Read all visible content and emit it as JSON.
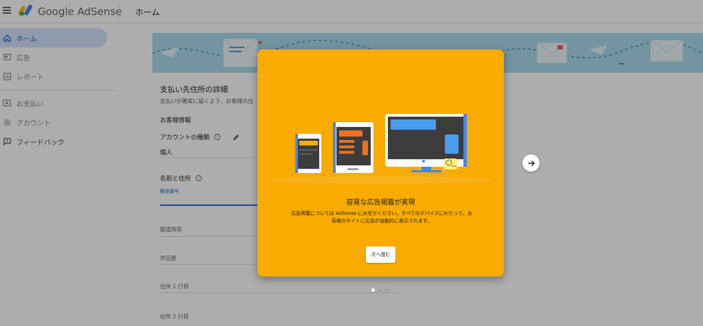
{
  "header": {
    "brand": "Google AdSense",
    "page_title": "ホーム"
  },
  "sidebar": {
    "items": [
      {
        "label": "ホーム",
        "icon": "home-icon",
        "active": true
      },
      {
        "label": "広告",
        "icon": "ads-icon",
        "active": false
      },
      {
        "label": "レポート",
        "icon": "reports-icon",
        "active": false
      },
      {
        "label": "お支払い",
        "icon": "payments-icon",
        "active": false
      },
      {
        "label": "アカウント",
        "icon": "gear-icon",
        "active": false
      },
      {
        "label": "フィードバック",
        "icon": "feedback-icon",
        "active": false
      }
    ]
  },
  "form": {
    "title": "支払い先住所の詳細",
    "subtitle": "支払いが確実に届くよう、お客様の住",
    "customer_info": "お客様情報",
    "account_type_label": "アカウントの種類",
    "account_type_value": "個人",
    "name_address_label": "名前と住所",
    "postal_code_label": "郵便番号",
    "prefecture_label": "都道府県",
    "city_label": "市区郡",
    "address1_label": "住所 1 行目",
    "address2_label": "住所 2 行目"
  },
  "dialog": {
    "title": "容易な広告掲載が実現",
    "body": "広告掲載については AdSense にお任せください。すべてのデバイスにわたって、お客様のサイトに広告が自動的に表示されます。",
    "next_button": "次へ進む"
  },
  "pager": {
    "total": 3,
    "current": 1
  },
  "colors": {
    "dialog_bg": "#f9ab00",
    "banner_bg": "#a8dcee",
    "accent_blue": "#1a73e8",
    "active_nav_bg": "#d3e3fd"
  }
}
